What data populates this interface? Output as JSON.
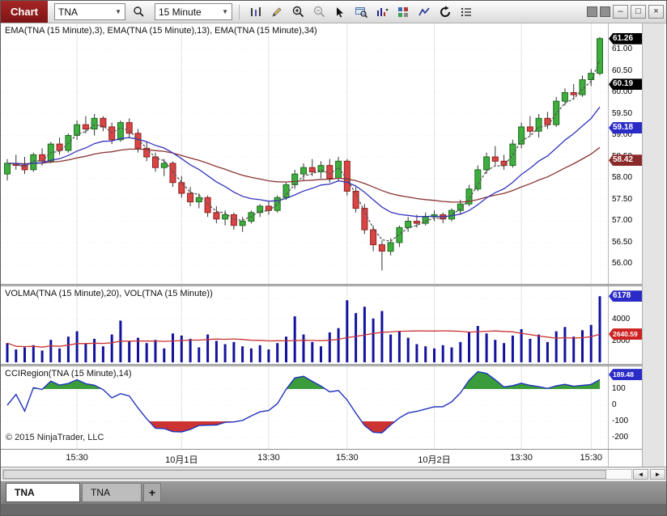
{
  "window": {
    "title": "Chart",
    "buttons": {
      "minimize": "–",
      "maximize": "□",
      "close": "×"
    }
  },
  "toolbar": {
    "instrument_value": "TNA",
    "interval_value": "15 Minute",
    "dropdown_arrow": "▼",
    "icons": [
      "chart-style",
      "drawing-tools",
      "zoom-in",
      "zoom-out",
      "cursor",
      "chart-trader",
      "data-series",
      "indicators",
      "line-chart",
      "reload",
      "properties"
    ]
  },
  "scrollbar": {
    "left_arrow": "◄",
    "right_arrow": "►"
  },
  "tabs": {
    "items": [
      {
        "label": "TNA",
        "active": true
      },
      {
        "label": "TNA",
        "active": false
      }
    ],
    "add_label": "+"
  },
  "panels": {
    "price": {
      "label": "EMA(TNA (15 Minute),3), EMA(TNA (15 Minute),13), EMA(TNA (15 Minute),34)"
    },
    "volume": {
      "label": "VOLMA(TNA (15 Minute),20), VOL(TNA (15 Minute))"
    },
    "cci": {
      "label": "CCIRegion(TNA (15 Minute),14)"
    }
  },
  "copyright": "© 2015 NinjaTrader, LLC",
  "chart_data": {
    "type": "candlestick",
    "instrument": "TNA",
    "interval": "15 Minute",
    "price_axis": {
      "min": 55.65,
      "max": 61.5,
      "ticks": [
        {
          "v": 61.0,
          "t": "61.00"
        },
        {
          "v": 60.5,
          "t": "60.50"
        },
        {
          "v": 60.0,
          "t": "60.00"
        },
        {
          "v": 59.5,
          "t": "59.50"
        },
        {
          "v": 59.0,
          "t": "59.00"
        },
        {
          "v": 58.5,
          "t": "58.50"
        },
        {
          "v": 58.0,
          "t": "58.00"
        },
        {
          "v": 57.5,
          "t": "57.50"
        },
        {
          "v": 57.0,
          "t": "57.00"
        },
        {
          "v": 56.5,
          "t": "56.50"
        },
        {
          "v": 56.0,
          "t": "56.00"
        }
      ]
    },
    "volume_axis": {
      "min": 0,
      "max": 6500,
      "ticks": [
        {
          "v": 6000,
          "t": "6000"
        },
        {
          "v": 4000,
          "t": "4000"
        },
        {
          "v": 2000,
          "t": "2000"
        }
      ]
    },
    "cci_axis": {
      "min": -240,
      "max": 210,
      "ticks": [
        {
          "v": 100,
          "t": "100"
        },
        {
          "v": 0,
          "t": "0"
        },
        {
          "v": -100,
          "t": "-100"
        },
        {
          "v": -200,
          "t": "-200"
        }
      ]
    },
    "tags": {
      "price": [
        {
          "v": 61.26,
          "t": "61.26",
          "bg": "#000000"
        },
        {
          "v": 60.19,
          "t": "60.19",
          "bg": "#000000"
        },
        {
          "v": 59.18,
          "t": "59.18",
          "bg": "#2b2bc8"
        },
        {
          "v": 58.42,
          "t": "58.42",
          "bg": "#8b2a2a"
        }
      ],
      "volume": [
        {
          "v": 6178,
          "t": "6178",
          "bg": "#2b2bc8"
        },
        {
          "v": 2640.59,
          "t": "2640.59",
          "bg": "#cc2222"
        }
      ],
      "cci": [
        {
          "v": 189.48,
          "t": "189.48",
          "bg": "#2b2bc8"
        }
      ]
    },
    "x_labels": [
      {
        "t": "15:30",
        "i": 8
      },
      {
        "t": "10月1日",
        "i": 20
      },
      {
        "t": "13:30",
        "i": 30
      },
      {
        "t": "15:30",
        "i": 39
      },
      {
        "t": "10月2日",
        "i": 49
      },
      {
        "t": "13:30",
        "i": 59
      },
      {
        "t": "15:30",
        "i": 67
      }
    ],
    "indicators": {
      "ema_periods": [
        3,
        13,
        34
      ],
      "volma_period": 20,
      "cci_period": 14
    },
    "last_values": {
      "price": 61.26,
      "ema3": 60.19,
      "ema13": 59.18,
      "ema34": 58.42,
      "vol": 6178,
      "volma": 2640.59,
      "cci": 189.48
    },
    "colors": {
      "up": "#3fae3f",
      "up_border": "#1c6b1c",
      "down": "#d94545",
      "down_border": "#8f1f1f",
      "wick": "#333333",
      "ema3": "#555555",
      "ema13": "#3333bb",
      "ema34": "#8b3333",
      "volume_bar": "#12129e",
      "volma": "#cc3333",
      "cci_line": "#2233bb",
      "cci_pos": "#3a9c3a",
      "cci_neg": "#cc3333"
    },
    "candles": [
      [
        58.1,
        58.45,
        57.95,
        58.35
      ],
      [
        58.35,
        58.55,
        58.2,
        58.3
      ],
      [
        58.3,
        58.5,
        58.1,
        58.2
      ],
      [
        58.2,
        58.6,
        58.15,
        58.55
      ],
      [
        58.55,
        58.7,
        58.3,
        58.4
      ],
      [
        58.4,
        58.85,
        58.35,
        58.8
      ],
      [
        58.8,
        58.95,
        58.55,
        58.65
      ],
      [
        58.65,
        59.05,
        58.6,
        59.0
      ],
      [
        59.0,
        59.35,
        58.9,
        59.25
      ],
      [
        59.25,
        59.45,
        59.05,
        59.15
      ],
      [
        59.15,
        59.5,
        59.0,
        59.4
      ],
      [
        59.4,
        59.45,
        59.1,
        59.2
      ],
      [
        59.2,
        59.3,
        58.8,
        58.9
      ],
      [
        58.9,
        59.35,
        58.85,
        59.3
      ],
      [
        59.3,
        59.4,
        58.95,
        59.05
      ],
      [
        59.05,
        59.15,
        58.6,
        58.7
      ],
      [
        58.7,
        58.85,
        58.4,
        58.5
      ],
      [
        58.5,
        58.6,
        58.15,
        58.25
      ],
      [
        58.25,
        58.45,
        58.05,
        58.35
      ],
      [
        58.35,
        58.4,
        57.8,
        57.9
      ],
      [
        57.9,
        58.05,
        57.55,
        57.65
      ],
      [
        57.65,
        57.8,
        57.35,
        57.45
      ],
      [
        57.45,
        57.65,
        57.3,
        57.55
      ],
      [
        57.55,
        57.6,
        57.1,
        57.2
      ],
      [
        57.2,
        57.35,
        56.95,
        57.05
      ],
      [
        57.05,
        57.25,
        56.9,
        57.15
      ],
      [
        57.15,
        57.2,
        56.8,
        56.9
      ],
      [
        56.9,
        57.1,
        56.75,
        57.0
      ],
      [
        57.0,
        57.25,
        56.95,
        57.2
      ],
      [
        57.2,
        57.4,
        57.1,
        57.35
      ],
      [
        57.35,
        57.45,
        57.15,
        57.25
      ],
      [
        57.25,
        57.6,
        57.2,
        57.55
      ],
      [
        57.55,
        57.9,
        57.5,
        57.85
      ],
      [
        57.85,
        58.2,
        57.75,
        58.1
      ],
      [
        58.1,
        58.35,
        57.95,
        58.25
      ],
      [
        58.25,
        58.45,
        58.05,
        58.15
      ],
      [
        58.15,
        58.4,
        58.0,
        58.3
      ],
      [
        58.3,
        58.45,
        57.9,
        58.0
      ],
      [
        58.0,
        58.5,
        57.95,
        58.4
      ],
      [
        58.4,
        58.45,
        57.6,
        57.7
      ],
      [
        57.7,
        57.8,
        57.2,
        57.3
      ],
      [
        57.3,
        57.4,
        56.7,
        56.8
      ],
      [
        56.8,
        56.9,
        56.3,
        56.45
      ],
      [
        56.45,
        56.55,
        55.85,
        56.3
      ],
      [
        56.3,
        56.6,
        56.2,
        56.5
      ],
      [
        56.5,
        56.9,
        56.4,
        56.85
      ],
      [
        56.85,
        57.1,
        56.75,
        57.0
      ],
      [
        57.0,
        57.15,
        56.85,
        56.95
      ],
      [
        56.95,
        57.2,
        56.9,
        57.1
      ],
      [
        57.1,
        57.25,
        57.0,
        57.15
      ],
      [
        57.15,
        57.2,
        56.95,
        57.05
      ],
      [
        57.05,
        57.3,
        57.0,
        57.25
      ],
      [
        57.25,
        57.5,
        57.15,
        57.4
      ],
      [
        57.4,
        57.85,
        57.35,
        57.75
      ],
      [
        57.75,
        58.3,
        57.7,
        58.2
      ],
      [
        58.2,
        58.6,
        58.1,
        58.5
      ],
      [
        58.5,
        58.75,
        58.3,
        58.4
      ],
      [
        58.4,
        58.55,
        58.2,
        58.3
      ],
      [
        58.3,
        58.9,
        58.25,
        58.8
      ],
      [
        58.8,
        59.3,
        58.7,
        59.2
      ],
      [
        59.2,
        59.45,
        59.0,
        59.1
      ],
      [
        59.1,
        59.5,
        58.95,
        59.4
      ],
      [
        59.4,
        59.55,
        59.15,
        59.25
      ],
      [
        59.25,
        59.9,
        59.2,
        59.8
      ],
      [
        59.8,
        60.1,
        59.7,
        60.0
      ],
      [
        60.0,
        60.2,
        59.85,
        59.95
      ],
      [
        59.95,
        60.4,
        59.9,
        60.3
      ],
      [
        60.3,
        60.55,
        60.15,
        60.45
      ],
      [
        60.45,
        61.3,
        60.4,
        61.26
      ]
    ],
    "volumes": [
      1800,
      1200,
      1400,
      1600,
      1100,
      2100,
      1300,
      2400,
      2900,
      1700,
      2200,
      1500,
      2600,
      3900,
      2000,
      2300,
      1800,
      2100,
      1300,
      2700,
      2500,
      2200,
      1400,
      2600,
      2000,
      1700,
      1900,
      1500,
      1300,
      1600,
      1200,
      1800,
      2400,
      4300,
      2600,
      1900,
      1500,
      2800,
      3200,
      5800,
      4600,
      5200,
      4100,
      4800,
      2600,
      2900,
      2300,
      1700,
      1500,
      1300,
      1600,
      1400,
      1900,
      2800,
      3400,
      2700,
      2100,
      1800,
      2500,
      3100,
      2200,
      2600,
      1900,
      2900,
      3300,
      2400,
      3000,
      3500,
      6178
    ]
  }
}
